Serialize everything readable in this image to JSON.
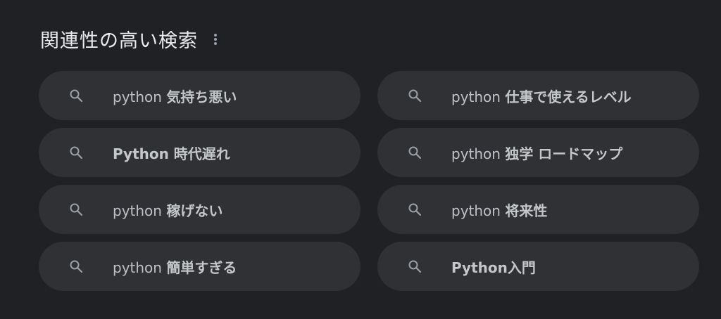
{
  "header": {
    "title": "関連性の高い検索",
    "more_icon": "more-vert-icon"
  },
  "searches": [
    {
      "base": "python ",
      "emph": "気持ち悪い"
    },
    {
      "base": "python ",
      "emph": "仕事で使えるレベル"
    },
    {
      "base": "",
      "emph": "Python 時代遅れ"
    },
    {
      "base": "python ",
      "emph": "独学 ロードマップ"
    },
    {
      "base": "python ",
      "emph": "稼げない"
    },
    {
      "base": "python ",
      "emph": "将来性"
    },
    {
      "base": "python ",
      "emph": "簡単すぎる"
    },
    {
      "base": "",
      "emph": "Python入門"
    }
  ],
  "icon": "search-icon",
  "colors": {
    "background": "#202124",
    "chip": "#303134",
    "text": "#bdc1c6"
  }
}
